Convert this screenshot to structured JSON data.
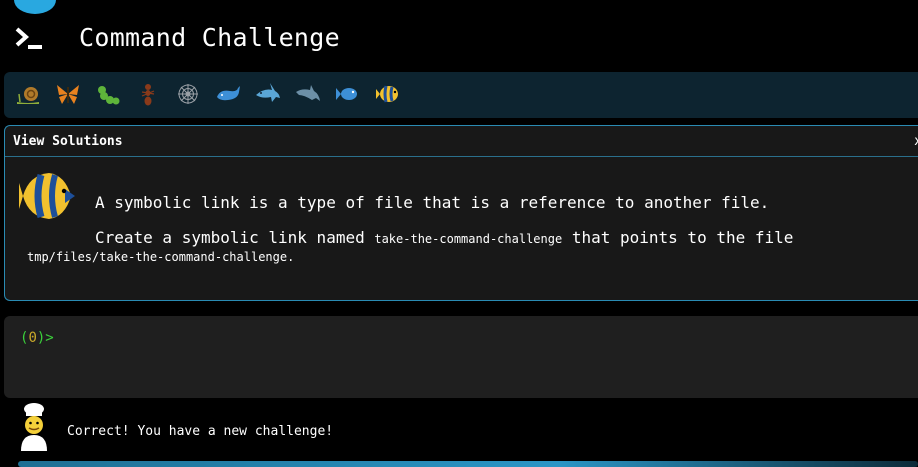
{
  "app": {
    "title": "Command Challenge"
  },
  "levels": [
    {
      "name": "snail-icon"
    },
    {
      "name": "butterfly-icon"
    },
    {
      "name": "caterpillar-icon"
    },
    {
      "name": "ant-icon"
    },
    {
      "name": "spider-web-icon"
    },
    {
      "name": "whale-icon"
    },
    {
      "name": "shark-icon"
    },
    {
      "name": "dolphin-icon"
    },
    {
      "name": "fish-icon"
    },
    {
      "name": "tropical-fish-icon"
    }
  ],
  "solutions": {
    "title": "View Solutions",
    "close_label": "x",
    "line1": "A symbolic link is a type of file that is a reference to another file.",
    "line2_prefix": "Create a symbolic link named ",
    "line2_code": "take-the-command-challenge",
    "line2_suffix": " that points to the file",
    "line3": "tmp/files/take-the-command-challenge."
  },
  "terminal": {
    "prompt_open": "(",
    "prompt_code": "0",
    "prompt_close": ")>"
  },
  "status": {
    "message": "Correct! You have a new challenge!"
  },
  "colors": {
    "accent": "#29a8e0",
    "prompt": "#3bd13b",
    "background": "#000000",
    "panel": "#181818"
  }
}
